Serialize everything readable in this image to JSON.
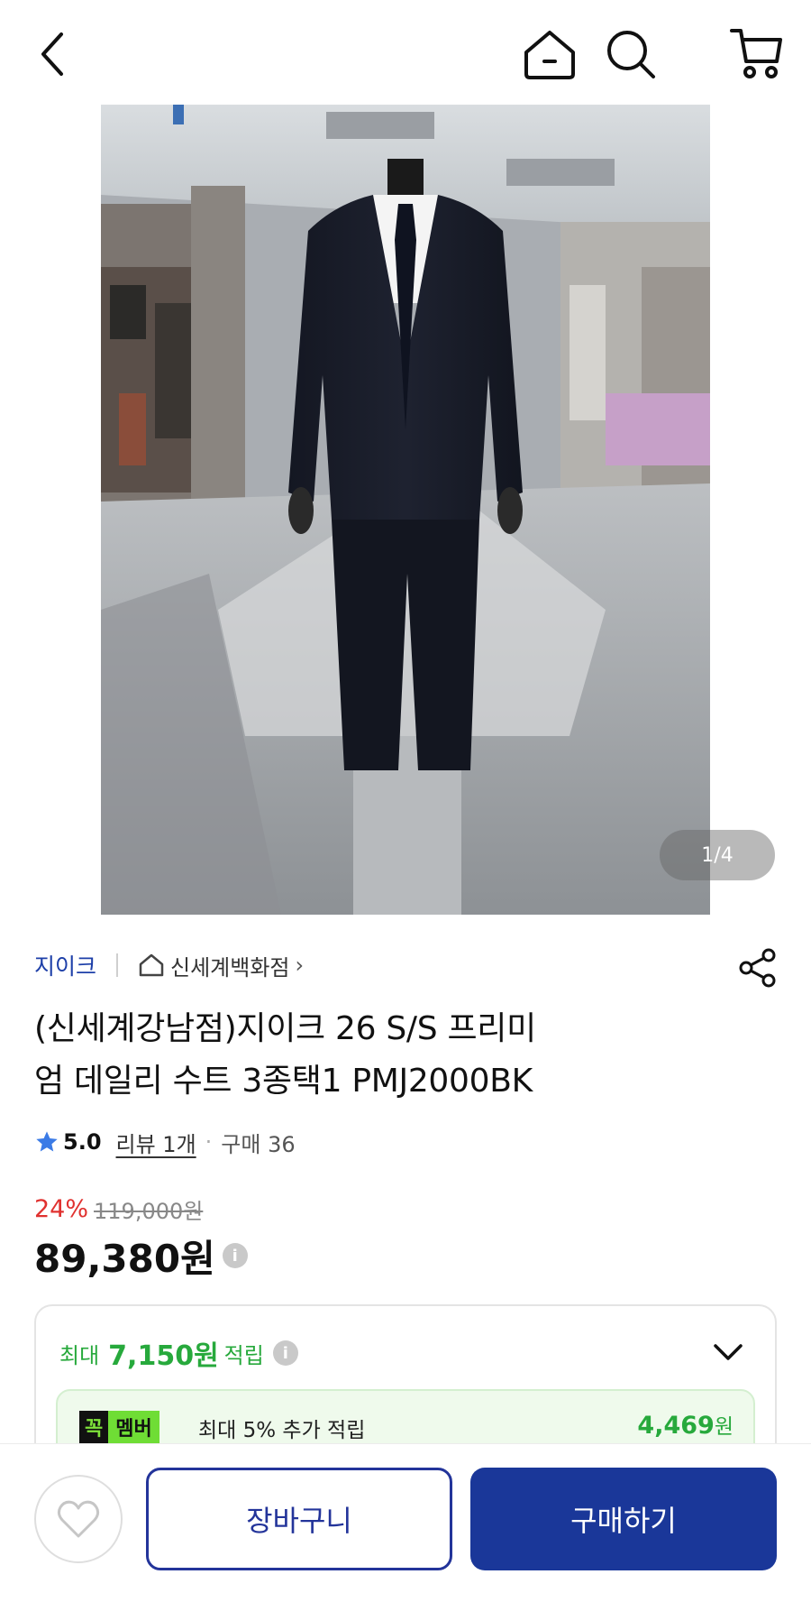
{
  "header": {
    "back_icon": "chevron-left-icon",
    "home_icon": "home-icon",
    "search_icon": "search-icon",
    "cart_icon": "cart-icon"
  },
  "gallery": {
    "image_desc": "navy suit on mannequin in department store",
    "pager": "1/4"
  },
  "product": {
    "brand": "지이크",
    "store": "신세계백화점",
    "title_line1": "(신세계강남점)지이크 26 S/S  프리미",
    "title_line2": "엄 데일리 수트 3종택1 PMJ2000BK",
    "rating": "5.0",
    "review": "리뷰 1개",
    "purchase": "구매 36",
    "discount_rate": "24%",
    "original_price": "119,000원",
    "price": "89,380원"
  },
  "points": {
    "label_prefix": "최대",
    "amount": "7,150원",
    "label_suffix": "적립",
    "member_badge_1": "꼭",
    "member_badge_2": "멤버",
    "member_text": "최대 5% 추가 적립",
    "member_amount": "4,469",
    "member_unit": "원"
  },
  "bottom": {
    "cart_label": "장바구니",
    "buy_label": "구매하기"
  },
  "colors": {
    "brand_blue": "#1a3799",
    "discount_red": "#e0312f",
    "points_green": "#27a93c"
  }
}
